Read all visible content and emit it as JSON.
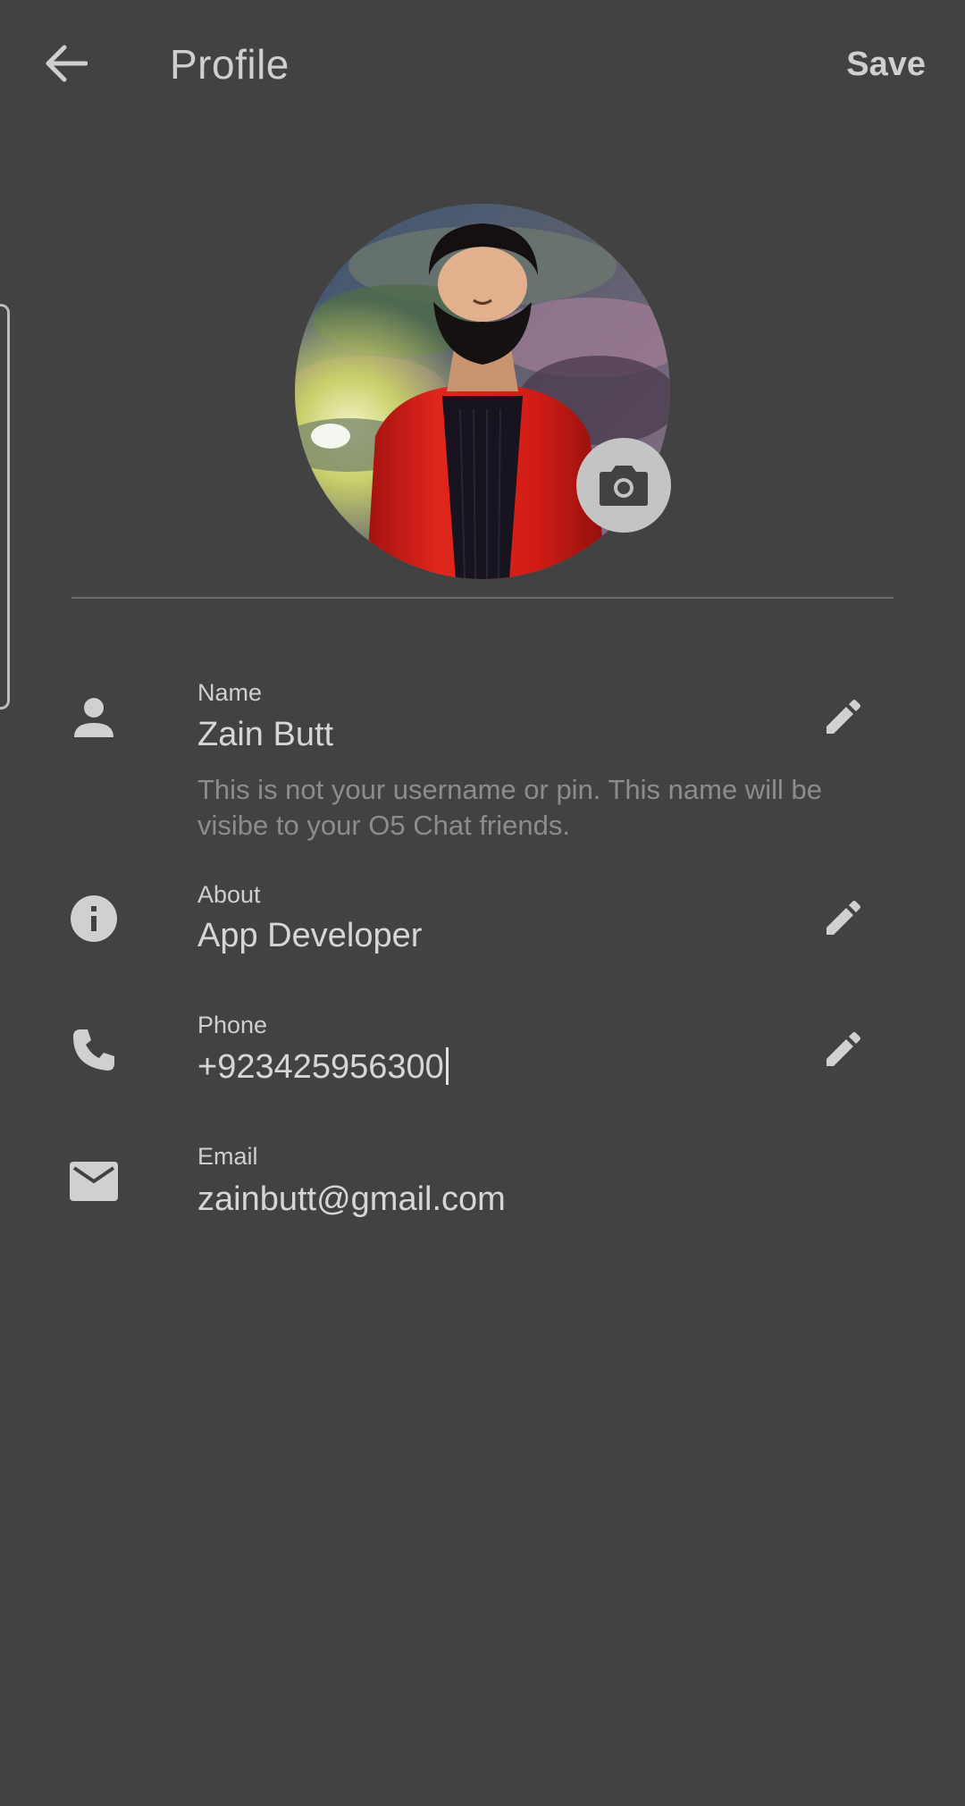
{
  "header": {
    "title": "Profile",
    "save_label": "Save",
    "back_icon": "arrow-left-icon"
  },
  "avatar": {
    "alt": "Profile photo",
    "camera_icon": "camera-icon"
  },
  "fields": {
    "name": {
      "label": "Name",
      "value": "Zain Butt",
      "hint": "This is not your username or pin. This name will be visibe to your O5 Chat friends.",
      "icon": "person-icon",
      "editable": true
    },
    "about": {
      "label": "About",
      "value": "App Developer",
      "icon": "info-icon",
      "editable": true
    },
    "phone": {
      "label": "Phone",
      "value": "+923425956300",
      "icon": "phone-icon",
      "editable": true
    },
    "email": {
      "label": "Email",
      "value": "zainbutt@gmail.com",
      "icon": "mail-icon",
      "editable": false
    }
  },
  "colors": {
    "background": "#424242",
    "text": "#d0d0d0",
    "hint": "#8c8c8c",
    "camera_button": "#c4c4c4"
  }
}
